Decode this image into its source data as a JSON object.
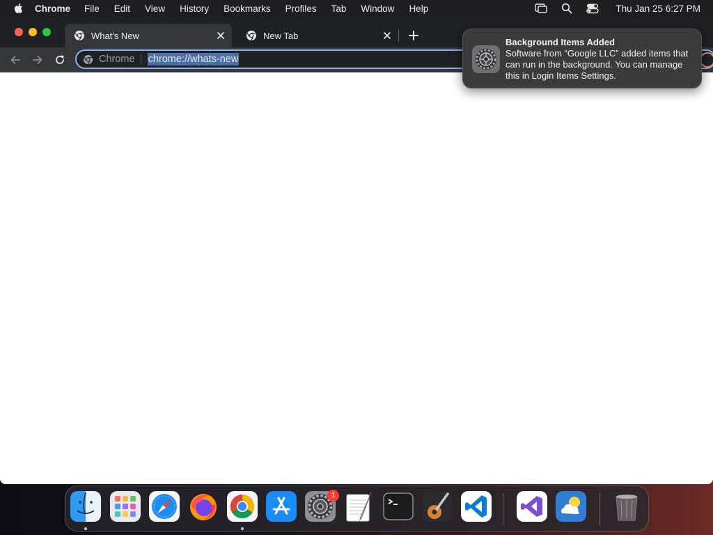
{
  "menubar": {
    "app_name": "Chrome",
    "items": [
      "File",
      "Edit",
      "View",
      "History",
      "Bookmarks",
      "Profiles",
      "Tab",
      "Window",
      "Help"
    ],
    "clock": "Thu Jan 25  6:27 PM",
    "status_icons": [
      "screen-mirroring-icon",
      "spotlight-search-icon",
      "control-center-icon"
    ]
  },
  "browser": {
    "tabs": [
      {
        "title": "What's New",
        "active": true
      },
      {
        "title": "New Tab",
        "active": false
      }
    ],
    "omnibox": {
      "chip_label": "Chrome",
      "url": "chrome://whats-new"
    }
  },
  "notification": {
    "title": "Background Items Added",
    "body": "Software from “Google LLC” added items that can run in the background. You can manage this in Login Items Settings."
  },
  "dock": {
    "apps": [
      {
        "name": "Finder",
        "running": true
      },
      {
        "name": "Launchpad",
        "running": false
      },
      {
        "name": "Safari",
        "running": false
      },
      {
        "name": "Firefox",
        "running": false
      },
      {
        "name": "Google Chrome",
        "running": true
      },
      {
        "name": "App Store",
        "running": false
      },
      {
        "name": "System Settings",
        "running": false,
        "badge": "1"
      },
      {
        "name": "TextEdit",
        "running": false
      },
      {
        "name": "Terminal",
        "running": false
      },
      {
        "name": "GarageBand",
        "running": false
      },
      {
        "name": "Visual Studio Code",
        "running": false
      },
      {
        "name": "Visual Studio",
        "running": false
      },
      {
        "name": "Weather",
        "running": false
      },
      {
        "name": "Trash",
        "running": false
      }
    ]
  },
  "colors": {
    "menubar_bg": "#1e1e22",
    "tabstrip_bg": "#202124",
    "toolbar_bg": "#35363a",
    "omnibox_focus": "#8ab4f8",
    "url_selection": "#4c6fa8",
    "notification_bg": "#3b3b3c",
    "badge": "#ff3b30"
  }
}
